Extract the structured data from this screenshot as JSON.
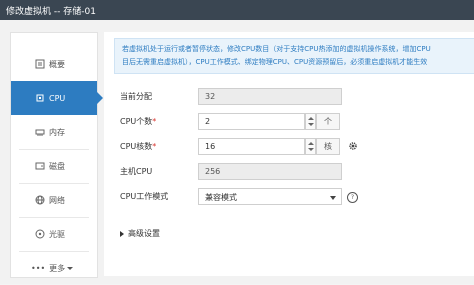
{
  "window": {
    "title": "修改虚拟机 -- 存储-01"
  },
  "sidebar": {
    "items": [
      {
        "label": "概要",
        "icon": "overview-icon"
      },
      {
        "label": "CPU",
        "icon": "cpu-icon"
      },
      {
        "label": "内存",
        "icon": "memory-icon"
      },
      {
        "label": "磁盘",
        "icon": "disk-icon"
      },
      {
        "label": "网络",
        "icon": "network-icon"
      },
      {
        "label": "光驱",
        "icon": "cdrom-icon"
      },
      {
        "label": "更多",
        "icon": "chevron-down-icon"
      }
    ],
    "more_prefix": "•••",
    "active_index": 1
  },
  "info": {
    "line1": "若虚拟机处于运行或者暂停状态，修改CPU数目（对于支持CPU热添加的虚拟机操作系统，增加CPU",
    "line2": "目后无需重启虚拟机），CPU工作模式、绑定物理CPU、CPU资源预留后，必须重启虚拟机才能生效"
  },
  "form": {
    "current_alloc": {
      "label": "当前分配",
      "value": "32"
    },
    "cpu_count": {
      "label": "CPU个数",
      "required_mark": "*",
      "value": "2",
      "unit": "个"
    },
    "cpu_cores": {
      "label": "CPU核数",
      "required_mark": "*",
      "value": "16",
      "unit": "核"
    },
    "host_cpu": {
      "label": "主机CPU",
      "value": "256"
    },
    "cpu_mode": {
      "label": "CPU工作模式",
      "value": "兼容模式"
    },
    "help_glyph": "?",
    "advanced": {
      "label": "高级设置"
    }
  },
  "colors": {
    "accent": "#2d7cc1",
    "titlebar": "#3a4652",
    "required": "#d9362f"
  }
}
